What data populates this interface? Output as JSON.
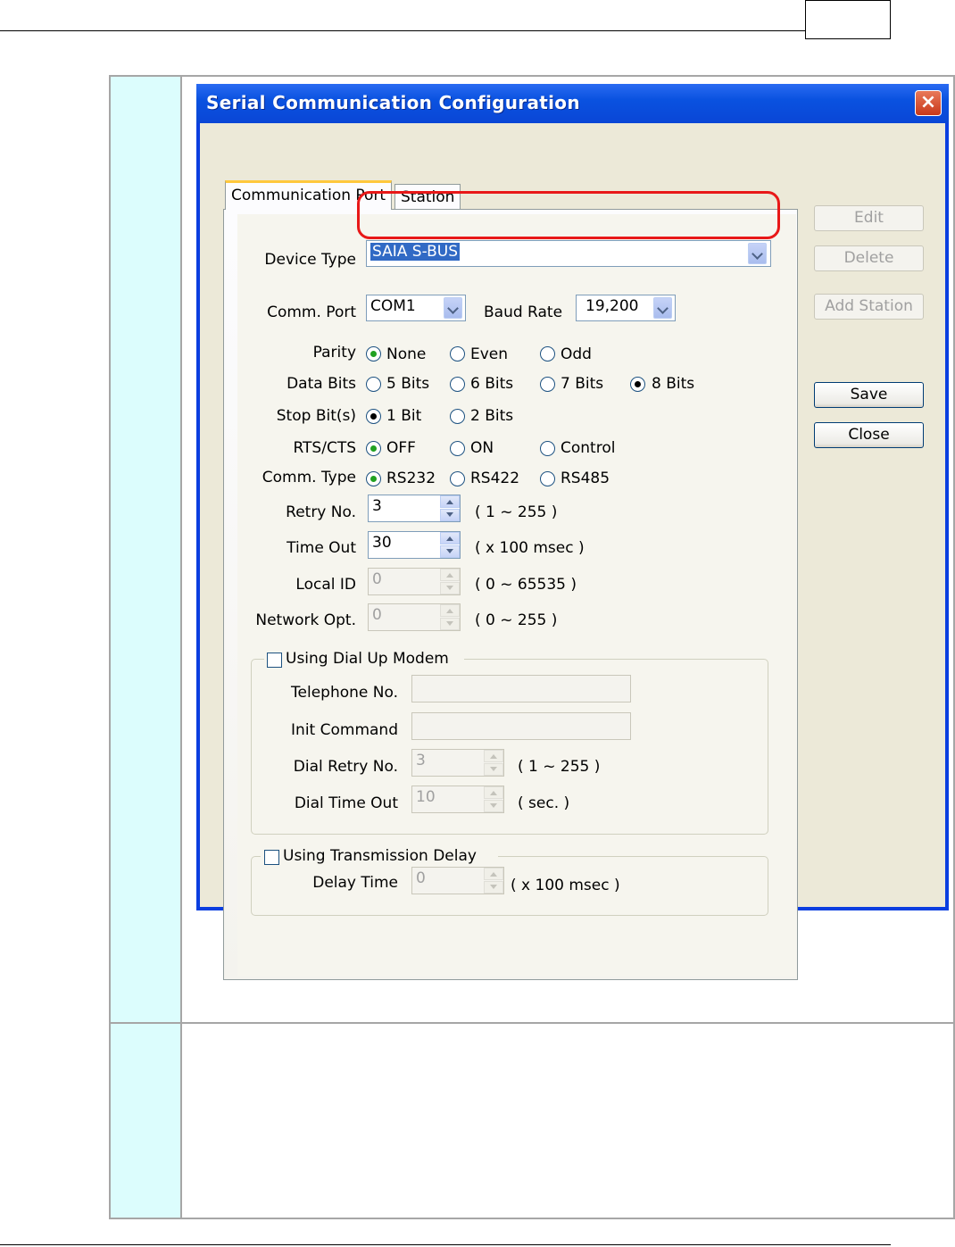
{
  "dialog": {
    "title": "Serial Communication Configuration",
    "close_glyph": "×"
  },
  "tabs": [
    {
      "label": "Communication Port"
    },
    {
      "label": "Station"
    }
  ],
  "fields": {
    "device_type_label": "Device Type",
    "device_type_value": "SAIA S-BUS",
    "comm_port_label": "Comm. Port",
    "comm_port_value": "COM1",
    "baud_rate_label": "Baud Rate",
    "baud_rate_value": "19,200",
    "parity_label": "Parity",
    "parity_options": [
      "None",
      "Even",
      "Odd"
    ],
    "parity_selected": "None",
    "data_bits_label": "Data Bits",
    "data_bits_options": [
      "5 Bits",
      "6 Bits",
      "7 Bits",
      "8 Bits"
    ],
    "data_bits_selected": "8 Bits",
    "stop_bits_label": "Stop Bit(s)",
    "stop_bits_options": [
      "1 Bit",
      "2 Bits"
    ],
    "stop_bits_selected": "1 Bit",
    "rts_cts_label": "RTS/CTS",
    "rts_cts_options": [
      "OFF",
      "ON",
      "Control"
    ],
    "rts_cts_selected": "OFF",
    "comm_type_label": "Comm. Type",
    "comm_type_options": [
      "RS232",
      "RS422",
      "RS485"
    ],
    "comm_type_selected": "RS232",
    "retry_label": "Retry No.",
    "retry_value": "3",
    "retry_range": "( 1 ~ 255 )",
    "timeout_label": "Time Out",
    "timeout_value": "30",
    "timeout_unit": "( x 100 msec )",
    "local_id_label": "Local ID",
    "local_id_value": "0",
    "local_id_range": "( 0 ~ 65535 )",
    "network_opt_label": "Network Opt.",
    "network_opt_value": "0",
    "network_opt_range": "( 0 ~ 255 )"
  },
  "modem": {
    "checkbox_label": "Using Dial Up Modem",
    "checked": false,
    "telephone_label": "Telephone No.",
    "telephone_value": "",
    "init_label": "Init Command",
    "init_value": "",
    "dial_retry_label": "Dial Retry No.",
    "dial_retry_value": "3",
    "dial_retry_range": "( 1 ~ 255 )",
    "dial_timeout_label": "Dial Time Out",
    "dial_timeout_value": "10",
    "dial_timeout_unit": "( sec. )"
  },
  "delay": {
    "checkbox_label": "Using Transmission Delay",
    "checked": false,
    "delay_label": "Delay Time",
    "delay_value": "0",
    "delay_unit": "( x 100 msec )"
  },
  "buttons": {
    "edit": "Edit",
    "delete": "Delete",
    "add_station": "Add Station",
    "save": "Save",
    "close": "Close"
  },
  "colors": {
    "title_bar": "#0a52e0",
    "highlight_border": "#e81818",
    "doc_left_cell": "#dcfdfd",
    "selected_radio": "#21a121"
  }
}
